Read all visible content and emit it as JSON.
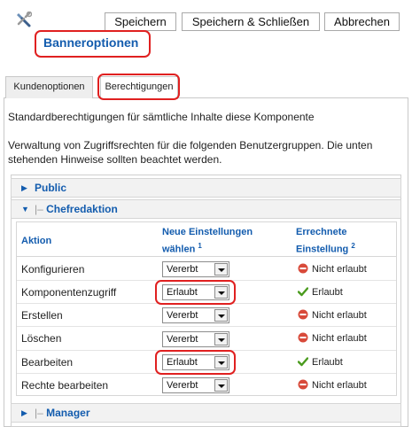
{
  "toolbar": {
    "icon": "tools-icon",
    "save_label": "Speichern",
    "save_close_label": "Speichern & Schließen",
    "cancel_label": "Abbrechen"
  },
  "page": {
    "title": "Banneroptionen"
  },
  "tabs": [
    {
      "label": "Kundenoptionen",
      "active": false
    },
    {
      "label": "Berechtigungen",
      "active": true
    }
  ],
  "content": {
    "description1": "Standardberechtigungen für sämtliche Inhalte diese Komponente",
    "description2": "Verwaltung von Zugriffsrechten für die folgenden Benutzergruppen. Die unten stehenden Hinweise sollten beachtet werden."
  },
  "groups": {
    "public": {
      "name": "Public",
      "expanded": false
    },
    "chef": {
      "separator": "|–",
      "name": "Chefredaktion",
      "expanded": true
    },
    "manager": {
      "separator": "|–",
      "name": "Manager",
      "expanded": false
    }
  },
  "table": {
    "col_action": "Aktion",
    "col_new_line1": "Neue Einstellungen",
    "col_new_line2": "wählen",
    "col_new_sup": "1",
    "col_calc_line1": "Errechnete",
    "col_calc_line2": "Einstellung",
    "col_calc_sup": "2",
    "rows": [
      {
        "action": "Konfigurieren",
        "setting": "Vererbt",
        "calculated": "Nicht erlaubt",
        "allowed": false
      },
      {
        "action": "Komponentenzugriff",
        "setting": "Erlaubt",
        "calculated": "Erlaubt",
        "allowed": true
      },
      {
        "action": "Erstellen",
        "setting": "Vererbt",
        "calculated": "Nicht erlaubt",
        "allowed": false
      },
      {
        "action": "Löschen",
        "setting": "Vererbt",
        "calculated": "Nicht erlaubt",
        "allowed": false
      },
      {
        "action": "Bearbeiten",
        "setting": "Erlaubt",
        "calculated": "Erlaubt",
        "allowed": true
      },
      {
        "action": "Rechte bearbeiten",
        "setting": "Vererbt",
        "calculated": "Nicht erlaubt",
        "allowed": false
      }
    ]
  },
  "colors": {
    "title": "#135cae",
    "highlight": "#e02020",
    "allowed": "#4a9b1e",
    "denied": "#d84a3a"
  }
}
